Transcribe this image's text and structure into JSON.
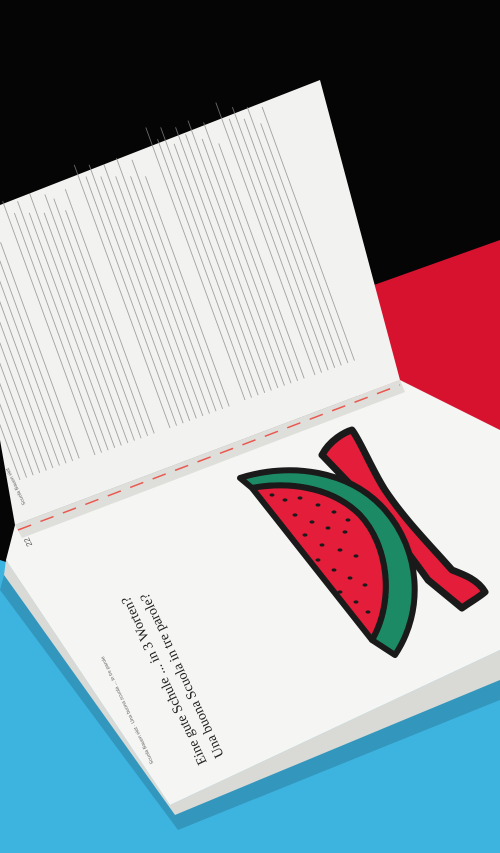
{
  "photo": {
    "colors": {
      "background_top": "#050505",
      "surface_red": "#d6122f",
      "surface_blue": "#3db4e0",
      "paper": "#f4f4f2",
      "watermelon_flesh": "#e41d3a",
      "watermelon_rind": "#1c8a64",
      "outline": "#1a1a1a",
      "stitch": "#e8584f"
    }
  },
  "book": {
    "right_page": {
      "title_line1": "Una buona Scuola in tre parole?",
      "title_line2": "Eine gute Schule ... in 3 Worten?",
      "footer": "Scuola Bauen ekit · Una buona scuola ... in tre parole",
      "page_number": "22",
      "header": "Scuola Bauen ekit"
    }
  }
}
